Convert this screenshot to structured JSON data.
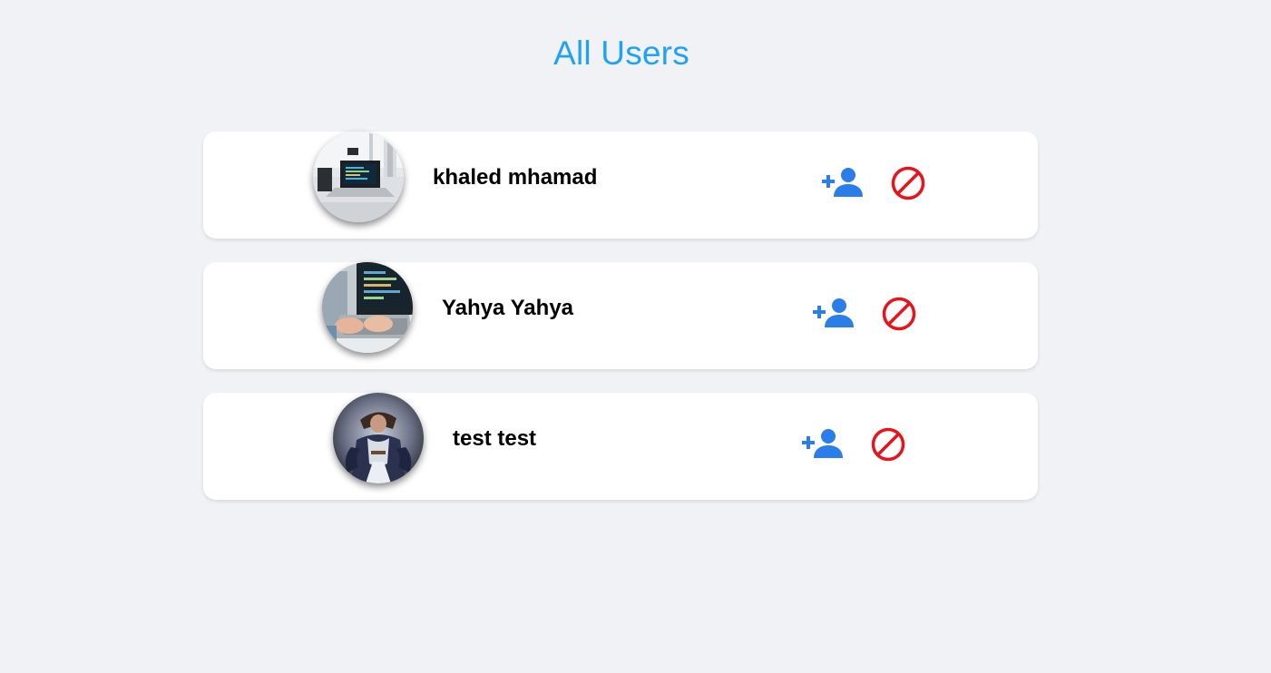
{
  "page": {
    "title": "All Users"
  },
  "colors": {
    "background": "#f0f2f5",
    "title": "#22a2f2",
    "add_icon": "#2b7de9",
    "block_icon": "#e8141c",
    "card": "#ffffff"
  },
  "users": [
    {
      "name": "khaled mhamad",
      "avatar_icon": "laptop-desk-photo",
      "add_icon": "person-add-icon",
      "block_icon": "block-icon"
    },
    {
      "name": "Yahya Yahya",
      "avatar_icon": "hands-typing-laptop-photo",
      "add_icon": "person-add-icon",
      "block_icon": "block-icon"
    },
    {
      "name": "test test",
      "avatar_icon": "fantasy-character-photo",
      "add_icon": "person-add-icon",
      "block_icon": "block-icon"
    }
  ]
}
